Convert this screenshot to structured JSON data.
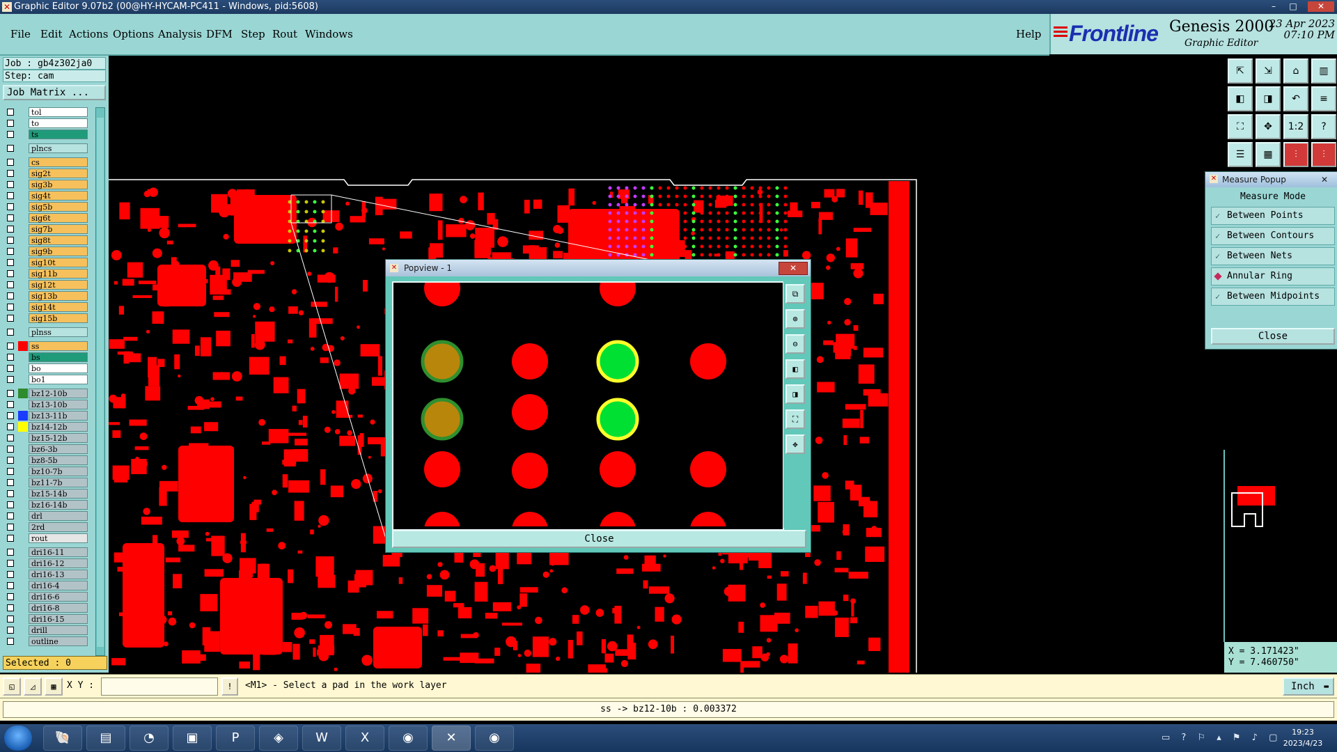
{
  "window": {
    "title": "Graphic Editor 9.07b2 (00@HY-HYCAM-PC411 - Windows, pid:5608)"
  },
  "menu": {
    "items": [
      "File",
      "Edit",
      "Actions",
      "Options",
      "Analysis",
      "DFM",
      "Step",
      "Rout",
      "Windows"
    ],
    "help": "Help"
  },
  "brand": {
    "logo": "Frontline",
    "product": "Genesis 2000",
    "subtitle": "Graphic Editor",
    "date": "23 Apr 2023",
    "time": "07:10 PM"
  },
  "job": {
    "job_label": "Job  : gb4z302ja0",
    "step_label": "Step: cam",
    "matrix_button": "Job Matrix ..."
  },
  "layers": [
    {
      "name": "tol",
      "color": "#ffffff",
      "swatch": ""
    },
    {
      "name": "to",
      "color": "#ffffff",
      "swatch": ""
    },
    {
      "name": "ts",
      "color": "#1f9b7a",
      "swatch": ""
    },
    {
      "name": "plncs",
      "color": "#b6e2e0",
      "swatch": "",
      "gap": true
    },
    {
      "name": "cs",
      "color": "#f6c15c",
      "swatch": "",
      "gap": true
    },
    {
      "name": "sig2t",
      "color": "#f6c15c",
      "swatch": ""
    },
    {
      "name": "sig3b",
      "color": "#f6c15c",
      "swatch": ""
    },
    {
      "name": "sig4t",
      "color": "#f6c15c",
      "swatch": ""
    },
    {
      "name": "sig5b",
      "color": "#f6c15c",
      "swatch": ""
    },
    {
      "name": "sig6t",
      "color": "#f6c15c",
      "swatch": ""
    },
    {
      "name": "sig7b",
      "color": "#f6c15c",
      "swatch": ""
    },
    {
      "name": "sig8t",
      "color": "#f6c15c",
      "swatch": ""
    },
    {
      "name": "sig9b",
      "color": "#f6c15c",
      "swatch": ""
    },
    {
      "name": "sig10t",
      "color": "#f6c15c",
      "swatch": ""
    },
    {
      "name": "sig11b",
      "color": "#f6c15c",
      "swatch": ""
    },
    {
      "name": "sig12t",
      "color": "#f6c15c",
      "swatch": ""
    },
    {
      "name": "sig13b",
      "color": "#f6c15c",
      "swatch": ""
    },
    {
      "name": "sig14t",
      "color": "#f6c15c",
      "swatch": ""
    },
    {
      "name": "sig15b",
      "color": "#f6c15c",
      "swatch": ""
    },
    {
      "name": "plnss",
      "color": "#b6e2e0",
      "swatch": "",
      "gap": true
    },
    {
      "name": "ss",
      "color": "#f6c15c",
      "swatch": "#ff0000",
      "gap": true
    },
    {
      "name": "bs",
      "color": "#1f9b7a",
      "swatch": ""
    },
    {
      "name": "bo",
      "color": "#ffffff",
      "swatch": ""
    },
    {
      "name": "bo1",
      "color": "#ffffff",
      "swatch": ""
    },
    {
      "name": "bz12-10b",
      "color": "#b2c3c8",
      "swatch": "#2e8b2e",
      "gap": true
    },
    {
      "name": "bz13-10b",
      "color": "#b2c3c8",
      "swatch": ""
    },
    {
      "name": "bz13-11b",
      "color": "#b2c3c8",
      "swatch": "#1a3cff"
    },
    {
      "name": "bz14-12b",
      "color": "#b2c3c8",
      "swatch": "#ffff00"
    },
    {
      "name": "bz15-12b",
      "color": "#b2c3c8",
      "swatch": ""
    },
    {
      "name": "bz6-3b",
      "color": "#b2c3c8",
      "swatch": ""
    },
    {
      "name": "bz8-5b",
      "color": "#b2c3c8",
      "swatch": ""
    },
    {
      "name": "bz10-7b",
      "color": "#b2c3c8",
      "swatch": ""
    },
    {
      "name": "bz11-7b",
      "color": "#b2c3c8",
      "swatch": ""
    },
    {
      "name": "bz15-14b",
      "color": "#b2c3c8",
      "swatch": ""
    },
    {
      "name": "bz16-14b",
      "color": "#b2c3c8",
      "swatch": ""
    },
    {
      "name": "drl",
      "color": "#b2c3c8",
      "swatch": ""
    },
    {
      "name": "2rd",
      "color": "#b2c3c8",
      "swatch": ""
    },
    {
      "name": "rout",
      "color": "#e6e6e6",
      "swatch": ""
    },
    {
      "name": "dri16-11",
      "color": "#b2c3c8",
      "swatch": "",
      "gap": true
    },
    {
      "name": "dri16-12",
      "color": "#b2c3c8",
      "swatch": ""
    },
    {
      "name": "dri16-13",
      "color": "#b2c3c8",
      "swatch": ""
    },
    {
      "name": "dri16-4",
      "color": "#b2c3c8",
      "swatch": ""
    },
    {
      "name": "dri16-6",
      "color": "#b2c3c8",
      "swatch": ""
    },
    {
      "name": "dri16-8",
      "color": "#b2c3c8",
      "swatch": ""
    },
    {
      "name": "dri16-15",
      "color": "#b2c3c8",
      "swatch": ""
    },
    {
      "name": "drill",
      "color": "#b2c3c8",
      "swatch": ""
    },
    {
      "name": "outline",
      "color": "#b2c3c8",
      "swatch": ""
    }
  ],
  "selected_label": "Selected : 0",
  "measure": {
    "title": "Measure Popup",
    "header": "Measure Mode",
    "options": [
      {
        "label": "Between Points",
        "active": false
      },
      {
        "label": "Between Contours",
        "active": false
      },
      {
        "label": "Between Nets",
        "active": false
      },
      {
        "label": "Annular Ring",
        "active": true
      },
      {
        "label": "Between Midpoints",
        "active": false
      }
    ],
    "close": "Close"
  },
  "popview": {
    "title": "Popview - 1",
    "close": "Close"
  },
  "coords": {
    "x": "X = 3.171423\"",
    "y": "Y = 7.460750\""
  },
  "command": {
    "xy_label": "X Y :",
    "xy_value": "",
    "prompt": "<M1> - Select a pad in the work layer",
    "unit": "Inch"
  },
  "status": "ss -> bz12-10b : 0.003372",
  "taskbar": {
    "time": "19:23",
    "date": "2023/4/23"
  },
  "colors": {
    "copper": "#ff0000",
    "panel": "#9ad6d4",
    "accent": "#5da9a6"
  }
}
